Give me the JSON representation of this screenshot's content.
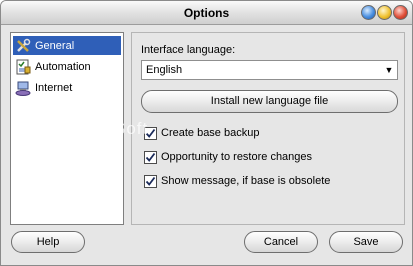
{
  "window": {
    "title": "Options"
  },
  "sidebar": {
    "items": [
      {
        "label": "General",
        "icon": "tools-icon",
        "selected": true
      },
      {
        "label": "Automation",
        "icon": "checklist-icon",
        "selected": false
      },
      {
        "label": "Internet",
        "icon": "network-icon",
        "selected": false
      }
    ]
  },
  "general": {
    "language_label": "Interface language:",
    "language_value": "English",
    "install_button": "Install new language file",
    "checkboxes": [
      {
        "label": "Create base backup",
        "checked": true
      },
      {
        "label": "Opportunity to restore changes",
        "checked": true
      },
      {
        "label": "Show message, if base is obsolete",
        "checked": true
      }
    ]
  },
  "buttons": {
    "help": "Help",
    "cancel": "Cancel",
    "save": "Save"
  },
  "watermark": "Soft"
}
